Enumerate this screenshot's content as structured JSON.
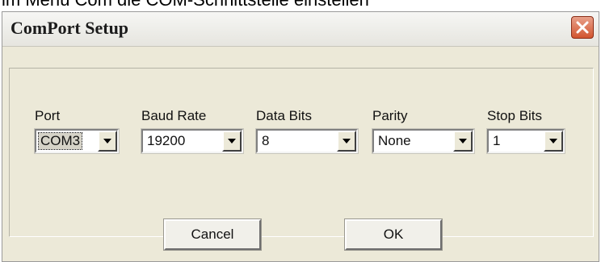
{
  "page_caption": "im Menü Com die COM-Schnittstelle einstellen",
  "dialog": {
    "title": "ComPort Setup",
    "close_icon": "close-icon",
    "fields": {
      "port": {
        "label": "Port",
        "value": "COM3"
      },
      "baud_rate": {
        "label": "Baud Rate",
        "value": "19200"
      },
      "data_bits": {
        "label": "Data Bits",
        "value": "8"
      },
      "parity": {
        "label": "Parity",
        "value": "None"
      },
      "stop_bits": {
        "label": "Stop Bits",
        "value": "1"
      }
    },
    "buttons": {
      "cancel": "Cancel",
      "ok": "OK"
    },
    "colors": {
      "close_button": "#d2552f",
      "dialog_face": "#ece9d8"
    }
  }
}
